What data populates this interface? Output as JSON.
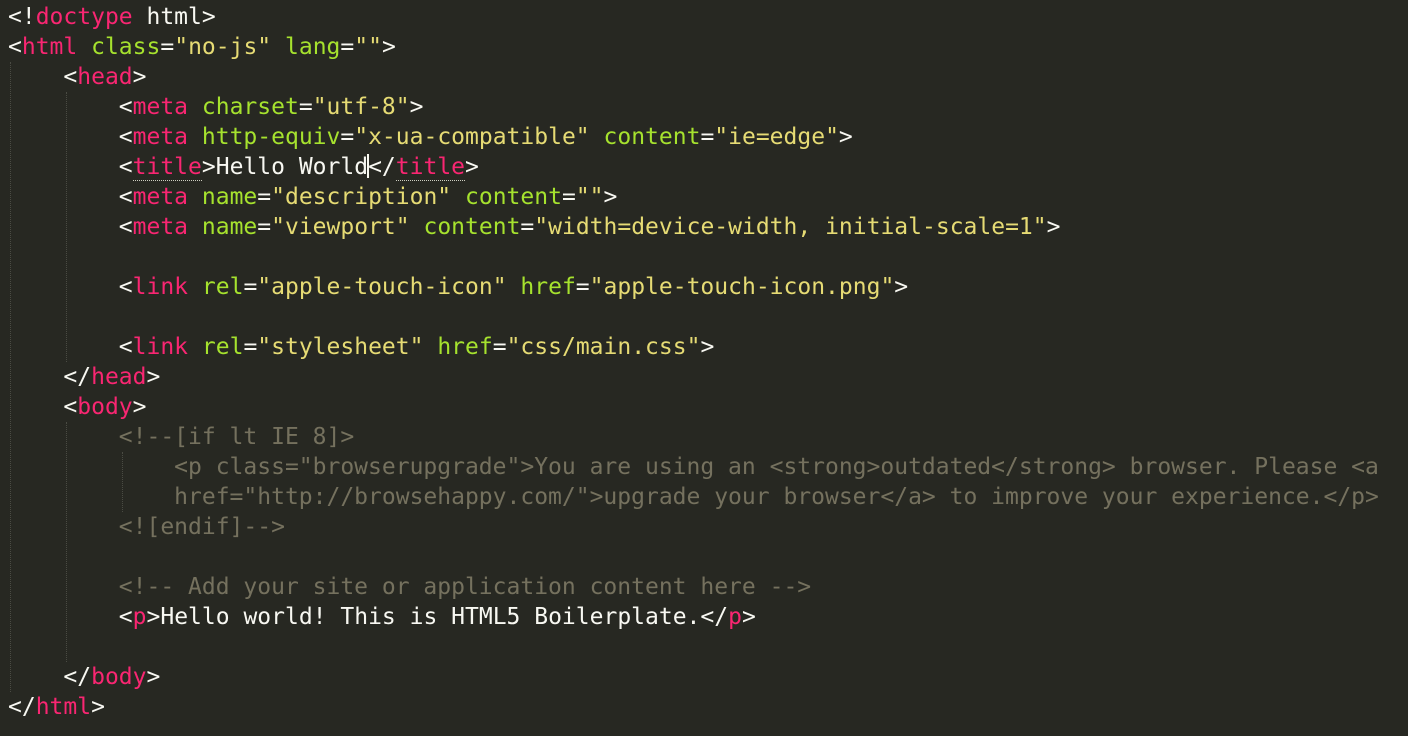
{
  "editor": {
    "theme": "monokai",
    "colors": {
      "background": "#272822",
      "tag": "#F92672",
      "attribute": "#A6E22E",
      "string": "#E6DB74",
      "text": "#F8F8F2",
      "comment": "#75715E"
    },
    "lines": [
      [
        {
          "t": "p",
          "v": "<!"
        },
        {
          "t": "tag",
          "v": "doctype"
        },
        {
          "t": "txt",
          "v": " html>"
        }
      ],
      [
        {
          "t": "p",
          "v": "<"
        },
        {
          "t": "tag",
          "v": "html"
        },
        {
          "t": "txt",
          "v": " "
        },
        {
          "t": "attr",
          "v": "class"
        },
        {
          "t": "p",
          "v": "="
        },
        {
          "t": "str",
          "v": "\"no-js\""
        },
        {
          "t": "txt",
          "v": " "
        },
        {
          "t": "attr",
          "v": "lang"
        },
        {
          "t": "p",
          "v": "="
        },
        {
          "t": "str",
          "v": "\"\""
        },
        {
          "t": "p",
          "v": ">"
        }
      ],
      [
        {
          "t": "txt",
          "v": "    "
        },
        {
          "t": "p",
          "v": "<"
        },
        {
          "t": "tag",
          "v": "head"
        },
        {
          "t": "p",
          "v": ">"
        }
      ],
      [
        {
          "t": "txt",
          "v": "        "
        },
        {
          "t": "p",
          "v": "<"
        },
        {
          "t": "tag",
          "v": "meta"
        },
        {
          "t": "txt",
          "v": " "
        },
        {
          "t": "attr",
          "v": "charset"
        },
        {
          "t": "p",
          "v": "="
        },
        {
          "t": "str",
          "v": "\"utf-8\""
        },
        {
          "t": "p",
          "v": ">"
        }
      ],
      [
        {
          "t": "txt",
          "v": "        "
        },
        {
          "t": "p",
          "v": "<"
        },
        {
          "t": "tag",
          "v": "meta"
        },
        {
          "t": "txt",
          "v": " "
        },
        {
          "t": "attr",
          "v": "http-equiv"
        },
        {
          "t": "p",
          "v": "="
        },
        {
          "t": "str",
          "v": "\"x-ua-compatible\""
        },
        {
          "t": "txt",
          "v": " "
        },
        {
          "t": "attr",
          "v": "content"
        },
        {
          "t": "p",
          "v": "="
        },
        {
          "t": "str",
          "v": "\"ie=edge\""
        },
        {
          "t": "p",
          "v": ">"
        }
      ],
      [
        {
          "t": "txt",
          "v": "        "
        },
        {
          "t": "p",
          "v": "<"
        },
        {
          "t": "tag",
          "v": "title",
          "m": 1
        },
        {
          "t": "p",
          "v": ">"
        },
        {
          "t": "txt",
          "v": "Hello World"
        },
        {
          "t": "caret"
        },
        {
          "t": "p",
          "v": "</"
        },
        {
          "t": "tag",
          "v": "title",
          "m": 1
        },
        {
          "t": "p",
          "v": ">"
        }
      ],
      [
        {
          "t": "txt",
          "v": "        "
        },
        {
          "t": "p",
          "v": "<"
        },
        {
          "t": "tag",
          "v": "meta"
        },
        {
          "t": "txt",
          "v": " "
        },
        {
          "t": "attr",
          "v": "name"
        },
        {
          "t": "p",
          "v": "="
        },
        {
          "t": "str",
          "v": "\"description\""
        },
        {
          "t": "txt",
          "v": " "
        },
        {
          "t": "attr",
          "v": "content"
        },
        {
          "t": "p",
          "v": "="
        },
        {
          "t": "str",
          "v": "\"\""
        },
        {
          "t": "p",
          "v": ">"
        }
      ],
      [
        {
          "t": "txt",
          "v": "        "
        },
        {
          "t": "p",
          "v": "<"
        },
        {
          "t": "tag",
          "v": "meta"
        },
        {
          "t": "txt",
          "v": " "
        },
        {
          "t": "attr",
          "v": "name"
        },
        {
          "t": "p",
          "v": "="
        },
        {
          "t": "str",
          "v": "\"viewport\""
        },
        {
          "t": "txt",
          "v": " "
        },
        {
          "t": "attr",
          "v": "content"
        },
        {
          "t": "p",
          "v": "="
        },
        {
          "t": "str",
          "v": "\"width=device-width, initial-scale=1\""
        },
        {
          "t": "p",
          "v": ">"
        }
      ],
      [],
      [
        {
          "t": "txt",
          "v": "        "
        },
        {
          "t": "p",
          "v": "<"
        },
        {
          "t": "tag",
          "v": "link"
        },
        {
          "t": "txt",
          "v": " "
        },
        {
          "t": "attr",
          "v": "rel"
        },
        {
          "t": "p",
          "v": "="
        },
        {
          "t": "str",
          "v": "\"apple-touch-icon\""
        },
        {
          "t": "txt",
          "v": " "
        },
        {
          "t": "attr",
          "v": "href"
        },
        {
          "t": "p",
          "v": "="
        },
        {
          "t": "str",
          "v": "\"apple-touch-icon.png\""
        },
        {
          "t": "p",
          "v": ">"
        }
      ],
      [],
      [
        {
          "t": "txt",
          "v": "        "
        },
        {
          "t": "p",
          "v": "<"
        },
        {
          "t": "tag",
          "v": "link"
        },
        {
          "t": "txt",
          "v": " "
        },
        {
          "t": "attr",
          "v": "rel"
        },
        {
          "t": "p",
          "v": "="
        },
        {
          "t": "str",
          "v": "\"stylesheet\""
        },
        {
          "t": "txt",
          "v": " "
        },
        {
          "t": "attr",
          "v": "href"
        },
        {
          "t": "p",
          "v": "="
        },
        {
          "t": "str",
          "v": "\"css/main.css\""
        },
        {
          "t": "p",
          "v": ">"
        }
      ],
      [
        {
          "t": "txt",
          "v": "    "
        },
        {
          "t": "p",
          "v": "</"
        },
        {
          "t": "tag",
          "v": "head"
        },
        {
          "t": "p",
          "v": ">"
        }
      ],
      [
        {
          "t": "txt",
          "v": "    "
        },
        {
          "t": "p",
          "v": "<"
        },
        {
          "t": "tag",
          "v": "body"
        },
        {
          "t": "p",
          "v": ">"
        }
      ],
      [
        {
          "t": "txt",
          "v": "        "
        },
        {
          "t": "cmt",
          "v": "<!--[if lt IE 8]>"
        }
      ],
      [
        {
          "t": "txt",
          "v": "            "
        },
        {
          "t": "cmt",
          "v": "<p class=\"browserupgrade\">You are using an <strong>outdated</strong> browser. Please <a"
        }
      ],
      [
        {
          "t": "txt",
          "v": "            "
        },
        {
          "t": "cmt",
          "v": "href=\"http://browsehappy.com/\">upgrade your browser</a> to improve your experience.</p>"
        }
      ],
      [
        {
          "t": "txt",
          "v": "        "
        },
        {
          "t": "cmt",
          "v": "<![endif]-->"
        }
      ],
      [],
      [
        {
          "t": "txt",
          "v": "        "
        },
        {
          "t": "cmt",
          "v": "<!-- Add your site or application content here -->"
        }
      ],
      [
        {
          "t": "txt",
          "v": "        "
        },
        {
          "t": "p",
          "v": "<"
        },
        {
          "t": "tag",
          "v": "p"
        },
        {
          "t": "p",
          "v": ">"
        },
        {
          "t": "txt",
          "v": "Hello world! This is HTML5 Boilerplate."
        },
        {
          "t": "p",
          "v": "</"
        },
        {
          "t": "tag",
          "v": "p"
        },
        {
          "t": "p",
          "v": ">"
        }
      ],
      [],
      [
        {
          "t": "txt",
          "v": "    "
        },
        {
          "t": "p",
          "v": "</"
        },
        {
          "t": "tag",
          "v": "body"
        },
        {
          "t": "p",
          "v": ">"
        }
      ],
      [
        {
          "t": "p",
          "v": "</"
        },
        {
          "t": "tag",
          "v": "html"
        },
        {
          "t": "p",
          "v": ">"
        }
      ]
    ]
  }
}
